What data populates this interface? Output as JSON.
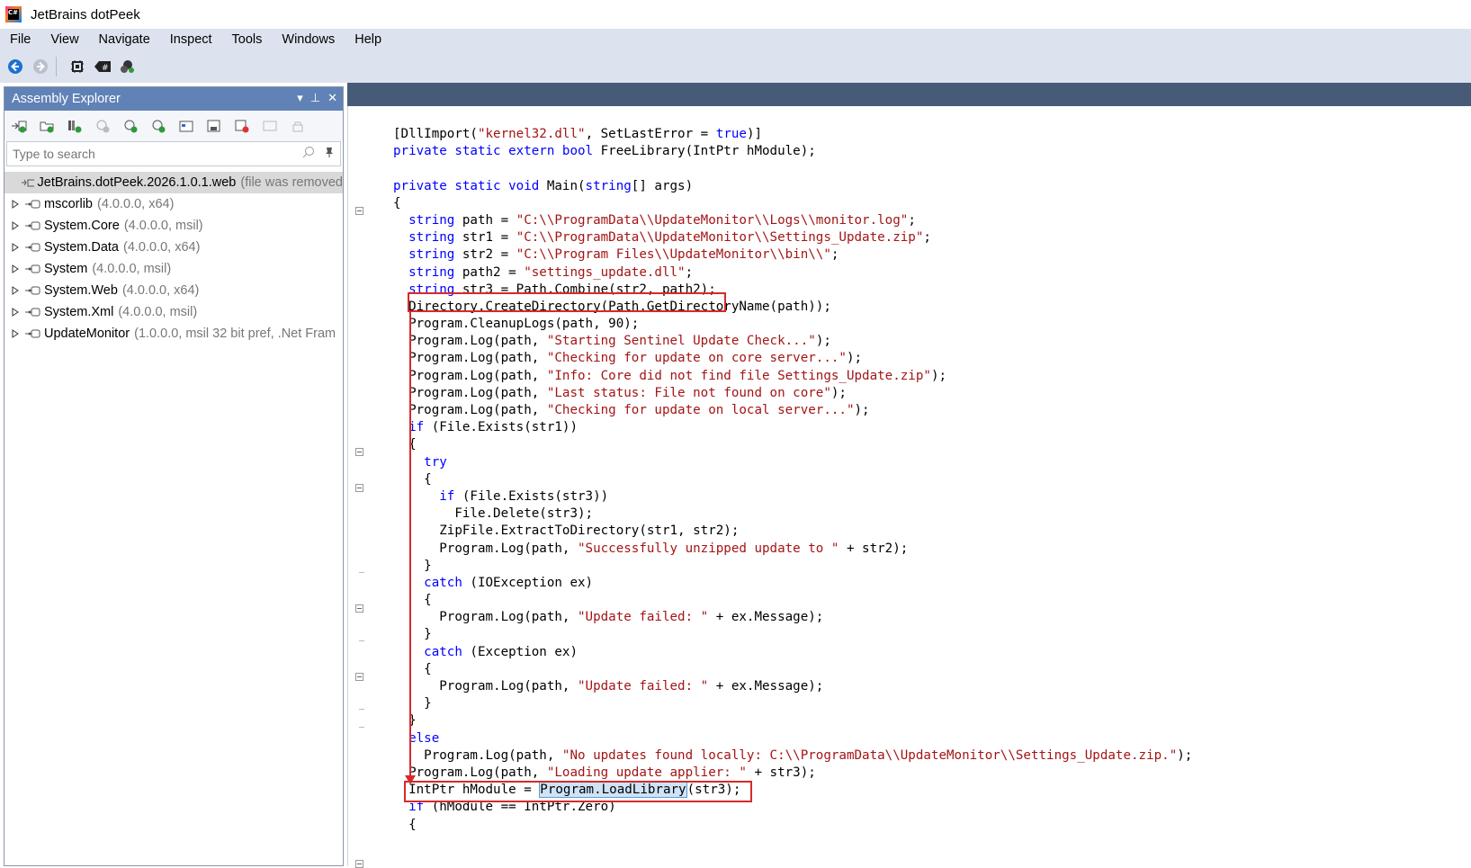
{
  "window": {
    "title": "JetBrains dotPeek"
  },
  "menu": [
    "File",
    "View",
    "Navigate",
    "Inspect",
    "Tools",
    "Windows",
    "Help"
  ],
  "toolbar": {
    "icons": [
      "back-arrow-icon",
      "forward-arrow-icon",
      "chip-icon",
      "csharp-file-icon",
      "assembly-tree-icon"
    ]
  },
  "assembly_explorer": {
    "title": "Assembly Explorer",
    "search_placeholder": "Type to search",
    "items": [
      {
        "name": "JetBrains.dotPeek.2026.1.0.1.web",
        "detail": "(file was removed",
        "selected": true,
        "expandable": false
      },
      {
        "name": "mscorlib",
        "detail": "(4.0.0.0, x64)",
        "selected": false,
        "expandable": true
      },
      {
        "name": "System.Core",
        "detail": "(4.0.0.0, msil)",
        "selected": false,
        "expandable": true
      },
      {
        "name": "System.Data",
        "detail": "(4.0.0.0, x64)",
        "selected": false,
        "expandable": true
      },
      {
        "name": "System",
        "detail": "(4.0.0.0, msil)",
        "selected": false,
        "expandable": true
      },
      {
        "name": "System.Web",
        "detail": "(4.0.0.0, x64)",
        "selected": false,
        "expandable": true
      },
      {
        "name": "System.Xml",
        "detail": "(4.0.0.0, msil)",
        "selected": false,
        "expandable": true
      },
      {
        "name": "UpdateMonitor",
        "detail": "(1.0.0.0, msil 32 bit pref, .Net Fram",
        "selected": false,
        "expandable": true
      }
    ]
  },
  "code_lines": [
    [
      [
        "p",
        "[DllImport("
      ],
      [
        "s",
        "\"kernel32.dll\""
      ],
      [
        "p",
        ", SetLastError = "
      ],
      [
        "k",
        "true"
      ],
      [
        "p",
        ")]"
      ]
    ],
    [
      [
        "k",
        "private static extern bool"
      ],
      [
        "p",
        " FreeLibrary(IntPtr hModule);"
      ]
    ],
    [
      [
        "p",
        ""
      ]
    ],
    [
      [
        "k",
        "private static void"
      ],
      [
        "p",
        " Main("
      ],
      [
        "k",
        "string"
      ],
      [
        "p",
        "[] args)"
      ]
    ],
    [
      [
        "p",
        "{"
      ]
    ],
    [
      [
        "p",
        "  "
      ],
      [
        "k",
        "string"
      ],
      [
        "p",
        " path = "
      ],
      [
        "s",
        "\"C:\\\\ProgramData\\\\UpdateMonitor\\\\Logs\\\\monitor.log\""
      ],
      [
        "p",
        ";"
      ]
    ],
    [
      [
        "p",
        "  "
      ],
      [
        "k",
        "string"
      ],
      [
        "p",
        " str1 = "
      ],
      [
        "s",
        "\"C:\\\\ProgramData\\\\UpdateMonitor\\\\Settings_Update.zip\""
      ],
      [
        "p",
        ";"
      ]
    ],
    [
      [
        "p",
        "  "
      ],
      [
        "k",
        "string"
      ],
      [
        "p",
        " str2 = "
      ],
      [
        "s",
        "\"C:\\\\Program Files\\\\UpdateMonitor\\\\bin\\\\\""
      ],
      [
        "p",
        ";"
      ]
    ],
    [
      [
        "p",
        "  "
      ],
      [
        "k",
        "string"
      ],
      [
        "p",
        " path2 = "
      ],
      [
        "s",
        "\"settings_update.dll\""
      ],
      [
        "p",
        ";"
      ]
    ],
    [
      [
        "p",
        "  "
      ],
      [
        "k",
        "string"
      ],
      [
        "p",
        " str3 = Path.Combine(str2, path2);"
      ]
    ],
    [
      [
        "p",
        "  Directory.CreateDirectory(Path.GetDirectoryName(path));"
      ]
    ],
    [
      [
        "p",
        "  Program.CleanupLogs(path, 90);"
      ]
    ],
    [
      [
        "p",
        "  Program.Log(path, "
      ],
      [
        "s",
        "\"Starting Sentinel Update Check...\""
      ],
      [
        "p",
        ");"
      ]
    ],
    [
      [
        "p",
        "  Program.Log(path, "
      ],
      [
        "s",
        "\"Checking for update on core server...\""
      ],
      [
        "p",
        ");"
      ]
    ],
    [
      [
        "p",
        "  Program.Log(path, "
      ],
      [
        "s",
        "\"Info: Core did not find file Settings_Update.zip\""
      ],
      [
        "p",
        ");"
      ]
    ],
    [
      [
        "p",
        "  Program.Log(path, "
      ],
      [
        "s",
        "\"Last status: File not found on core\""
      ],
      [
        "p",
        ");"
      ]
    ],
    [
      [
        "p",
        "  Program.Log(path, "
      ],
      [
        "s",
        "\"Checking for update on local server...\""
      ],
      [
        "p",
        ");"
      ]
    ],
    [
      [
        "p",
        "  "
      ],
      [
        "k",
        "if"
      ],
      [
        "p",
        " (File.Exists(str1))"
      ]
    ],
    [
      [
        "p",
        "  {"
      ]
    ],
    [
      [
        "p",
        "    "
      ],
      [
        "k",
        "try"
      ]
    ],
    [
      [
        "p",
        "    {"
      ]
    ],
    [
      [
        "p",
        "      "
      ],
      [
        "k",
        "if"
      ],
      [
        "p",
        " (File.Exists(str3))"
      ]
    ],
    [
      [
        "p",
        "        File.Delete(str3);"
      ]
    ],
    [
      [
        "p",
        "      ZipFile.ExtractToDirectory(str1, str2);"
      ]
    ],
    [
      [
        "p",
        "      Program.Log(path, "
      ],
      [
        "s",
        "\"Successfully unzipped update to \""
      ],
      [
        "p",
        " + str2);"
      ]
    ],
    [
      [
        "p",
        "    }"
      ]
    ],
    [
      [
        "p",
        "    "
      ],
      [
        "k",
        "catch"
      ],
      [
        "p",
        " (IOException ex)"
      ]
    ],
    [
      [
        "p",
        "    {"
      ]
    ],
    [
      [
        "p",
        "      Program.Log(path, "
      ],
      [
        "s",
        "\"Update failed: \""
      ],
      [
        "p",
        " + ex.Message);"
      ]
    ],
    [
      [
        "p",
        "    }"
      ]
    ],
    [
      [
        "p",
        "    "
      ],
      [
        "k",
        "catch"
      ],
      [
        "p",
        " (Exception ex)"
      ]
    ],
    [
      [
        "p",
        "    {"
      ]
    ],
    [
      [
        "p",
        "      Program.Log(path, "
      ],
      [
        "s",
        "\"Update failed: \""
      ],
      [
        "p",
        " + ex.Message);"
      ]
    ],
    [
      [
        "p",
        "    }"
      ]
    ],
    [
      [
        "p",
        "  }"
      ]
    ],
    [
      [
        "p",
        "  "
      ],
      [
        "k",
        "else"
      ]
    ],
    [
      [
        "p",
        "    Program.Log(path, "
      ],
      [
        "s",
        "\"No updates found locally: C:\\\\ProgramData\\\\UpdateMonitor\\\\Settings_Update.zip.\""
      ],
      [
        "p",
        ");"
      ]
    ],
    [
      [
        "p",
        "  Program.Log(path, "
      ],
      [
        "s",
        "\"Loading update applier: \""
      ],
      [
        "p",
        " + str3);"
      ]
    ],
    [
      [
        "p",
        "  IntPtr hModule = "
      ],
      [
        "sel",
        "Program.LoadLibrary"
      ],
      [
        "p",
        "(str3);"
      ]
    ],
    [
      [
        "p",
        "  "
      ],
      [
        "k",
        "if"
      ],
      [
        "p",
        " (hModule == IntPtr.Zero)"
      ]
    ],
    [
      [
        "p",
        "  {"
      ]
    ]
  ],
  "highlights": {
    "color": "#d62a2a",
    "boxes": [
      "string str3 = Path.Combine(str2, path2);",
      "IntPtr hModule = Program.LoadLibrary(str3);"
    ]
  }
}
